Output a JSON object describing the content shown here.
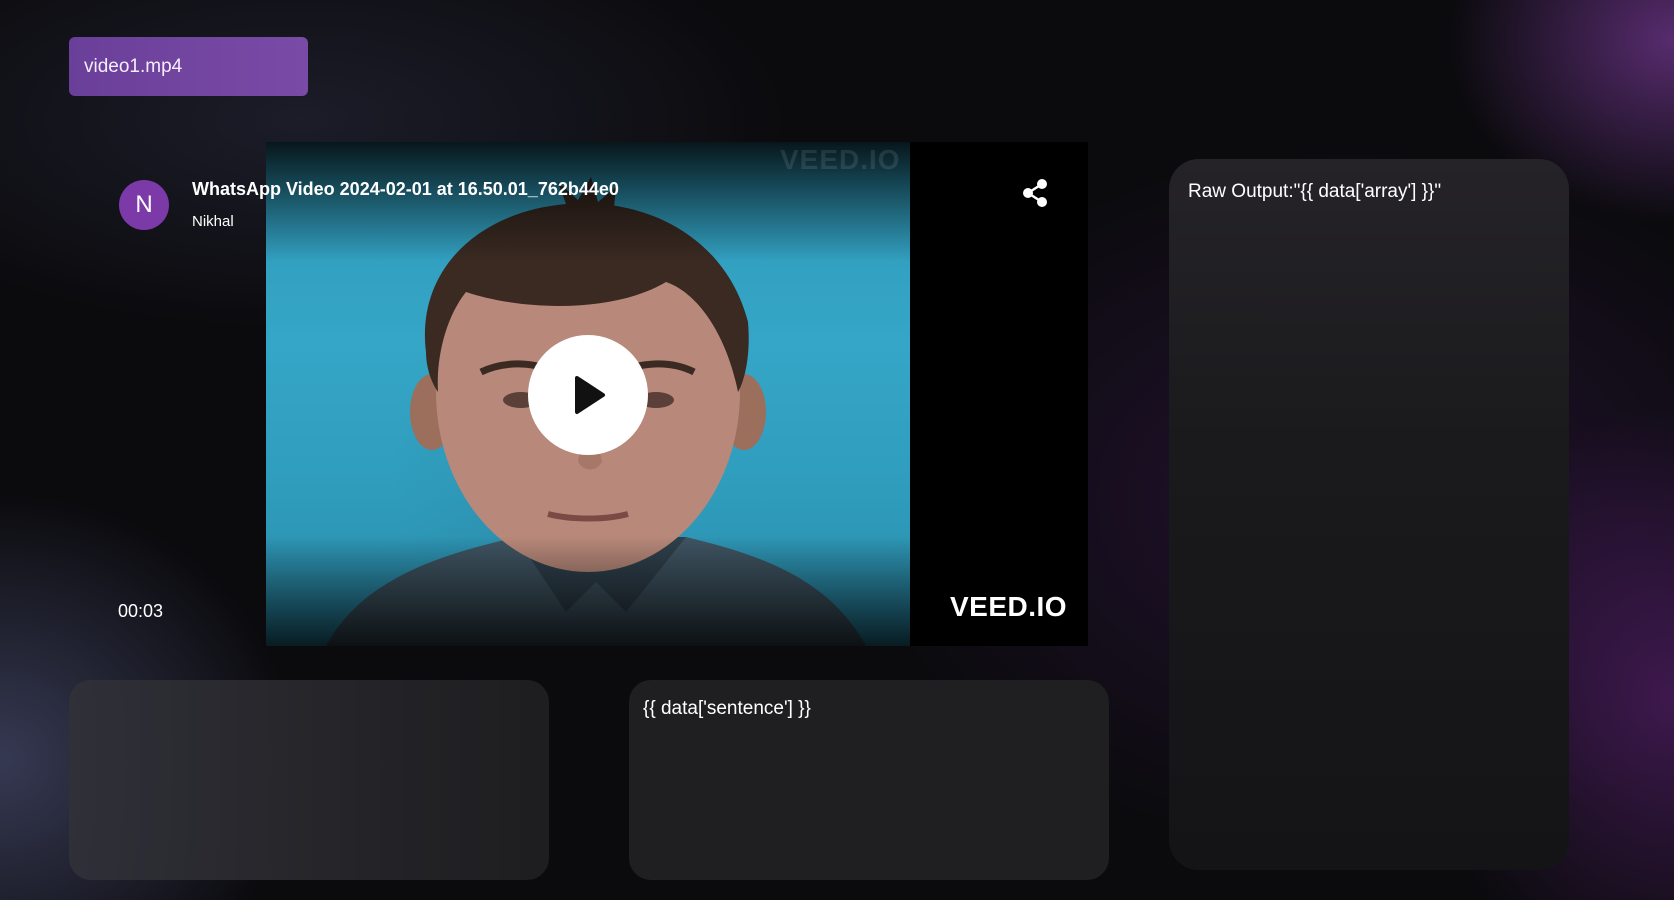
{
  "file_selector": {
    "label": "video1.mp4"
  },
  "video": {
    "title": "WhatsApp Video 2024-02-01 at 16.50.01_762b44e0",
    "author": "Nikhal",
    "avatar_initial": "N",
    "timestamp": "00:03",
    "watermark": "VEED.IO",
    "play_icon": "play-icon",
    "share_icon": "share-icon"
  },
  "panels": {
    "left": {
      "text": ""
    },
    "sentence": {
      "text": "{{ data['sentence'] }}"
    },
    "raw_output": {
      "text": "Raw Output:\"{{ data['array'] }}\""
    }
  },
  "colors": {
    "accent": "#7c3aa9",
    "chip": "#6a3f99",
    "background": "#0b0b0e",
    "panel": "#1f1f21"
  }
}
